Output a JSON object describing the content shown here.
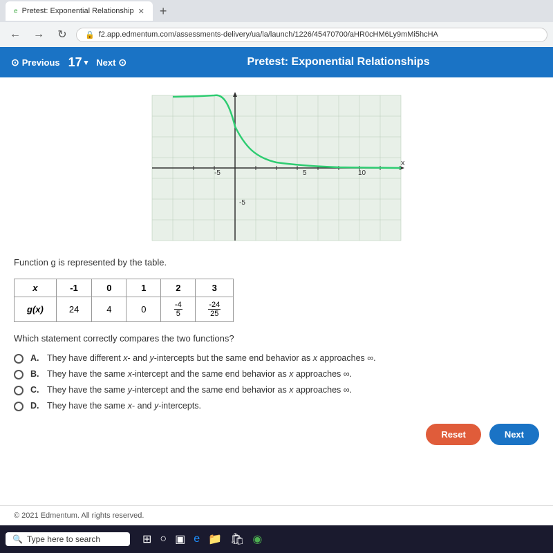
{
  "browser": {
    "tab_label": "Pretest: Exponential Relationship",
    "tab_icon": "e",
    "address": "f2.app.edmentum.com/assessments-delivery/ua/la/launch/1226/45470700/aHR0cHM6Ly9mMi5hcHA",
    "new_tab_label": "+"
  },
  "header": {
    "previous_label": "Previous",
    "next_label": "Next",
    "question_number": "17",
    "title": "Pretest: Exponential Relationships"
  },
  "graph": {
    "x_labels": [
      "-5",
      "5",
      "10"
    ],
    "y_labels": [
      "-5"
    ],
    "x_axis_label": "x"
  },
  "function_label": "Function g is represented by the table.",
  "table": {
    "headers": [
      "x",
      "-1",
      "0",
      "1",
      "2",
      "3"
    ],
    "row_label": "g(x)",
    "values": [
      "24",
      "4",
      "0",
      "-4/5",
      "-24/25"
    ]
  },
  "question": "Which statement correctly compares the two functions?",
  "choices": [
    {
      "letter": "A.",
      "text": "They have different x- and y-intercepts but the same end behavior as x approaches ∞."
    },
    {
      "letter": "B.",
      "text": "They have the same x-intercept and the same end behavior as x approaches ∞."
    },
    {
      "letter": "C.",
      "text": "They have the same y-intercept and the same end behavior as x approaches ∞."
    },
    {
      "letter": "D.",
      "text": "They have the same x- and y-intercepts."
    }
  ],
  "buttons": {
    "reset_label": "Reset",
    "next_label": "Next"
  },
  "footer": {
    "copyright": "© 2021 Edmentum. All rights reserved."
  },
  "taskbar": {
    "search_placeholder": "Type here to search"
  }
}
